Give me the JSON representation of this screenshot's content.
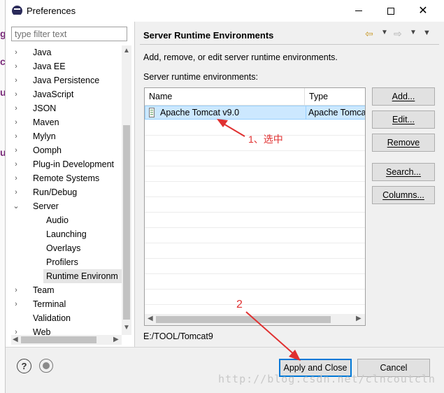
{
  "window": {
    "title": "Preferences",
    "minimize_glyph": "",
    "close_glyph": "✕"
  },
  "filter": {
    "placeholder": "type filter text"
  },
  "tree": {
    "items": [
      {
        "label": "Java",
        "expanded": false
      },
      {
        "label": "Java EE",
        "expanded": false
      },
      {
        "label": "Java Persistence",
        "expanded": false
      },
      {
        "label": "JavaScript",
        "expanded": false
      },
      {
        "label": "JSON",
        "expanded": false
      },
      {
        "label": "Maven",
        "expanded": false
      },
      {
        "label": "Mylyn",
        "expanded": false
      },
      {
        "label": "Oomph",
        "expanded": false
      },
      {
        "label": "Plug-in Development",
        "expanded": false
      },
      {
        "label": "Remote Systems",
        "expanded": false
      },
      {
        "label": "Run/Debug",
        "expanded": false
      },
      {
        "label": "Server",
        "expanded": true
      },
      {
        "label": "Audio",
        "child": true
      },
      {
        "label": "Launching",
        "child": true
      },
      {
        "label": "Overlays",
        "child": true
      },
      {
        "label": "Profilers",
        "child": true
      },
      {
        "label": "Runtime Environm",
        "child": true,
        "selected": true
      },
      {
        "label": "Team",
        "expanded": false
      },
      {
        "label": "Terminal",
        "expanded": false
      },
      {
        "label": "Validation",
        "leaf": true
      },
      {
        "label": "Web",
        "expanded": false
      }
    ]
  },
  "page": {
    "title": "Server Runtime Environments",
    "description": "Add, remove, or edit server runtime environments.",
    "list_label": "Server runtime environments:",
    "columns": {
      "name": "Name",
      "type": "Type"
    },
    "rows": [
      {
        "name": "Apache Tomcat v9.0",
        "type": "Apache Tomcat"
      }
    ],
    "location": "E:/TOOL/Tomcat9"
  },
  "buttons": {
    "add": "Add...",
    "edit": "Edit...",
    "remove": "Remove",
    "search": "Search...",
    "columns": "Columns...",
    "apply_close": "Apply and Close",
    "cancel": "Cancel"
  },
  "annotations": {
    "note1": "1、选中",
    "note2": "2",
    "color": "#e03030"
  },
  "watermark": "http://blog.csdn.net/clncoutcln"
}
